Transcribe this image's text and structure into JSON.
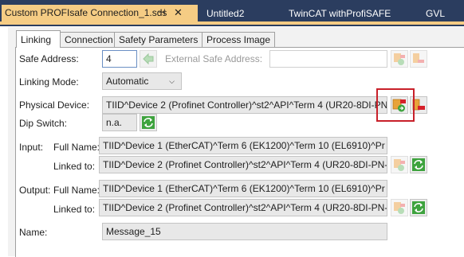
{
  "doc_tabs": {
    "active": "Custom PROFIsafe Connection_1.sds",
    "pin": "⊣",
    "close": "✕",
    "others": [
      "Untitled2",
      "TwinCAT withProfiSAFE",
      "GVL"
    ]
  },
  "inner_tabs": [
    "Linking",
    "Connection",
    "Safety Parameters",
    "Process Image"
  ],
  "form": {
    "safe_address_label": "Safe Address:",
    "safe_address_value": "4",
    "external_safe_address_label": "External Safe Address:",
    "external_safe_address_value": "",
    "linking_mode_label": "Linking Mode:",
    "linking_mode_value": "Automatic",
    "physical_device_label": "Physical Device:",
    "physical_device_value": "TIID^Device 2 (Profinet Controller)^st2^API^Term 4 (UR20-8DI-PN-",
    "dip_switch_label": "Dip Switch:",
    "dip_switch_value": "n.a.",
    "input_label": "Input:",
    "full_name_label": "Full Name:",
    "input_full_name": "TIID^Device 1 (EtherCAT)^Term 6 (EK1200)^Term 10 (EL6910)^Pr",
    "linked_to_label": "Linked to:",
    "input_linked_to": "TIID^Device 2 (Profinet Controller)^st2^API^Term 4 (UR20-8DI-PN-",
    "output_label": "Output:",
    "output_full_name": "TIID^Device 1 (EtherCAT)^Term 6 (EK1200)^Term 10 (EL6910)^Pr",
    "output_linked_to": "TIID^Device 2 (Profinet Controller)^st2^API^Term 4 (UR20-8DI-PN-",
    "name_label": "Name:",
    "name_value": "Message_15"
  },
  "colors": {
    "doc_tab_bar": "#2b3d5f",
    "active_doc_tab": "#f5cc84",
    "highlight_box": "#c8202a",
    "refresh_green": "#3ea33e"
  },
  "icons": [
    "link-device-icon",
    "unlink-device-icon",
    "refresh-icon",
    "arrow-left-icon"
  ]
}
